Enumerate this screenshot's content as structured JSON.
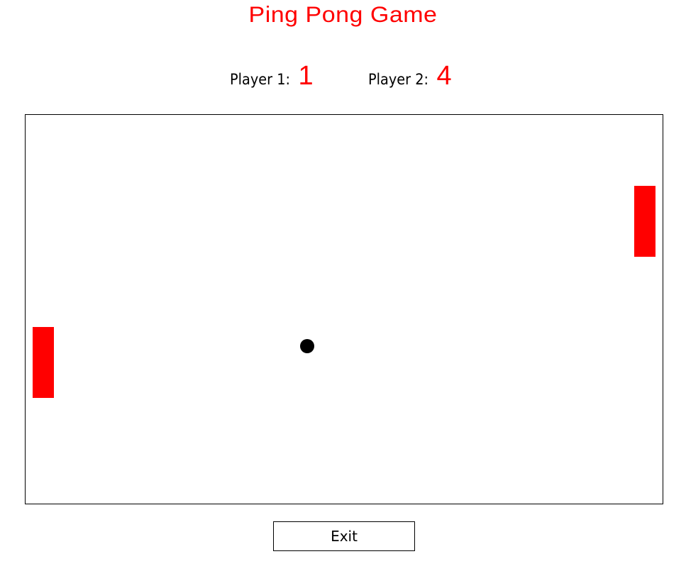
{
  "header": {
    "title": "Ping Pong Game"
  },
  "scoreboard": {
    "player1_label": "Player 1:",
    "player1_score": "1",
    "player2_label": "Player 2:",
    "player2_score": "4"
  },
  "game": {
    "paddle_color": "#ff0000",
    "ball_color": "#000000",
    "border_color": "#000000"
  },
  "controls": {
    "exit_label": "Exit"
  }
}
